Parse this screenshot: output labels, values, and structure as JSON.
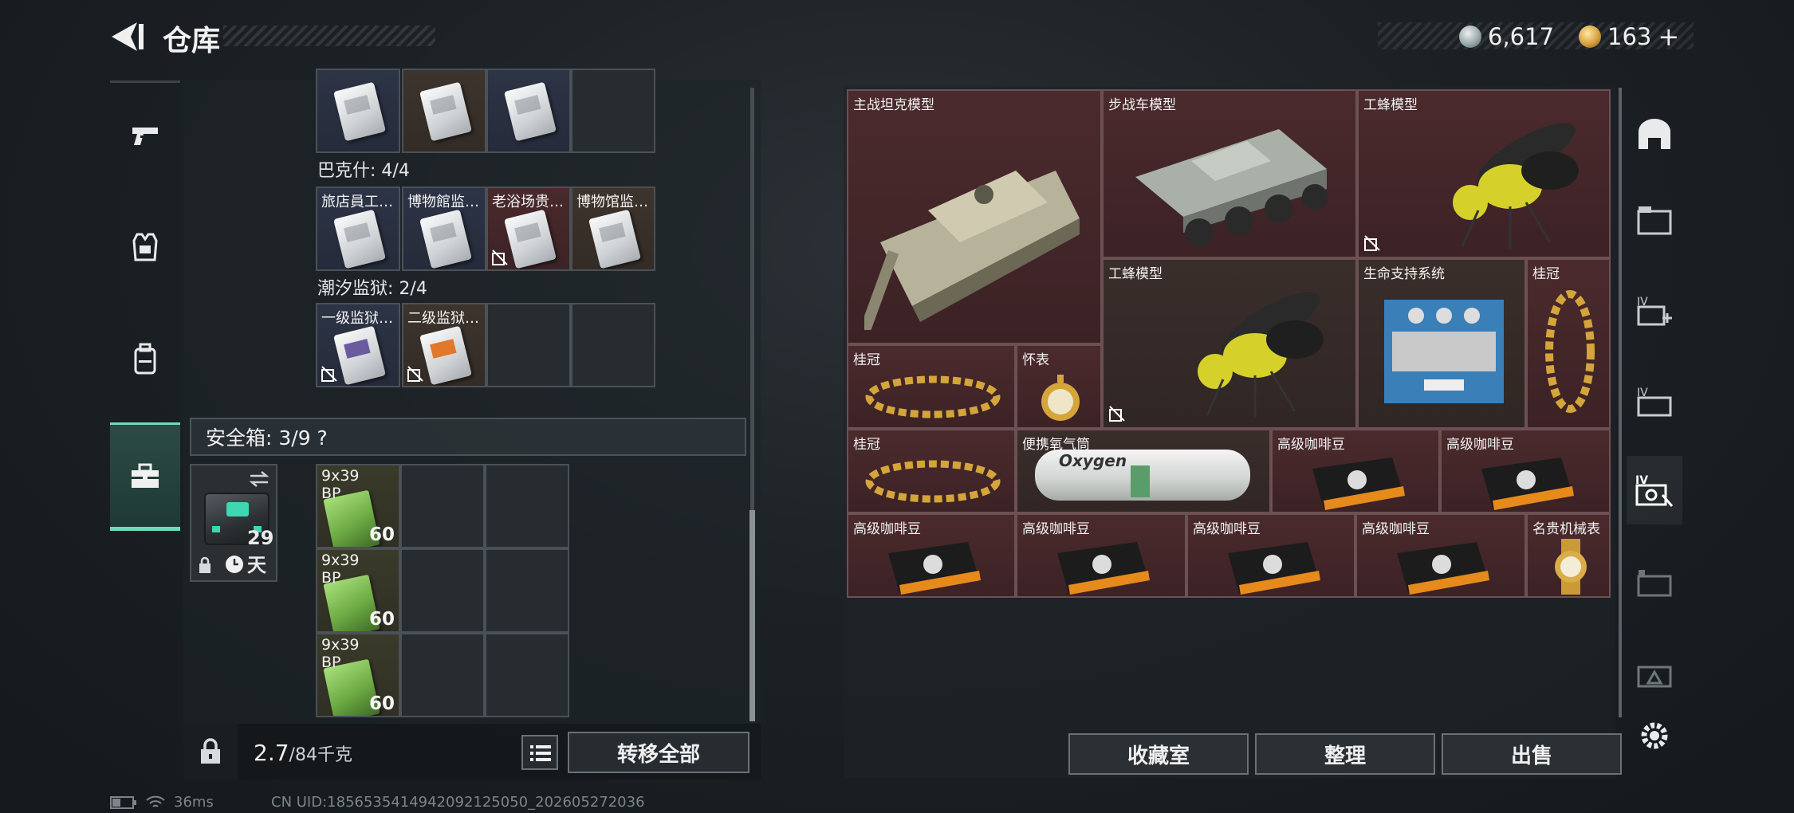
{
  "header": {
    "title": "仓库",
    "silver": "6,617",
    "gold": "163",
    "gold_plus": "+"
  },
  "left_nav": {
    "items": [
      {
        "icon": "pistol-icon"
      },
      {
        "icon": "armor-vest-icon"
      },
      {
        "icon": "backpack-icon"
      },
      {
        "icon": "toolbox-icon",
        "active": true
      }
    ]
  },
  "keycards": {
    "group1_label": "巴克什: 4/4",
    "group1": [
      "旅店員工…",
      "博物館监…",
      "老浴场贵…",
      "博物馆监…"
    ],
    "group2_label": "潮汐监狱: 2/4",
    "group2": [
      "一级监狱…",
      "二级监狱…"
    ]
  },
  "safe_box": {
    "label": "安全箱: 3/9 ?",
    "days": "29天",
    "ammo": [
      {
        "cal": "9x39",
        "type": "BP",
        "count": "60"
      },
      {
        "cal": "9x39",
        "type": "BP",
        "count": "60"
      },
      {
        "cal": "9x39",
        "type": "BP",
        "count": "60"
      }
    ]
  },
  "bottom": {
    "weight": "2.7",
    "weight_max": "/84千克",
    "transfer_all": "转移全部"
  },
  "collection": {
    "items": [
      "主战坦克模型",
      "步战车模型",
      "工蜂模型",
      "工蜂模型",
      "生命支持系统",
      "桂冠",
      "桂冠",
      "怀表",
      "桂冠",
      "便携氧气筒",
      "高级咖啡豆",
      "高级咖啡豆",
      "高级咖啡豆",
      "高级咖啡豆",
      "高级咖啡豆",
      "高级咖啡豆",
      "名贵机械表"
    ],
    "oxygen_text": "Oxygen"
  },
  "actions": {
    "collection_room": "收藏室",
    "sort": "整理",
    "sell": "出售"
  },
  "status": {
    "ping": "36ms",
    "uid": "CN UID:1856535414942092125050_202605272036"
  }
}
